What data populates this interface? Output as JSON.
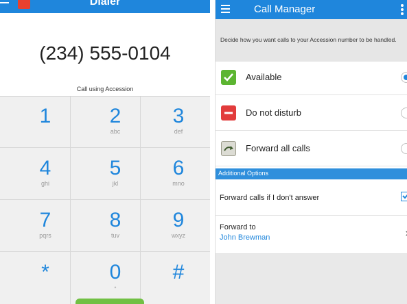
{
  "dialer": {
    "title": "Dialer",
    "phone_number": "(234) 555-0104",
    "call_using_label": "Call using Accession",
    "keys": [
      {
        "digit": "1",
        "letters": ""
      },
      {
        "digit": "2",
        "letters": "abc"
      },
      {
        "digit": "3",
        "letters": "def"
      },
      {
        "digit": "4",
        "letters": "ghi"
      },
      {
        "digit": "5",
        "letters": "jkl"
      },
      {
        "digit": "6",
        "letters": "mno"
      },
      {
        "digit": "7",
        "letters": "pqrs"
      },
      {
        "digit": "8",
        "letters": "tuv"
      },
      {
        "digit": "9",
        "letters": "wxyz"
      },
      {
        "digit": "*",
        "letters": ""
      },
      {
        "digit": "0",
        "letters": ""
      },
      {
        "digit": "#",
        "letters": ""
      }
    ],
    "call_button_color": "#71c044"
  },
  "call_manager": {
    "title": "Call Manager",
    "description": "Decide how you want calls to your Accession number to be handled.",
    "options": [
      {
        "label": "Available",
        "icon": "checkmark-icon",
        "color": "#5cb531",
        "selected": true
      },
      {
        "label": "Do not disturb",
        "icon": "minus-icon",
        "color": "#e23c3c",
        "selected": false
      },
      {
        "label": "Forward all calls",
        "icon": "forward-arrow-icon",
        "color": "#4a5a4a",
        "selected": false
      }
    ],
    "additional_options_header": "Additional Options",
    "forward_if_no_answer": {
      "label": "Forward calls if I don't answer",
      "checked": true
    },
    "forward_to": {
      "label": "Forward to",
      "value": "John Brewman"
    }
  },
  "colors": {
    "accent": "#1f86dc",
    "header_bg": "#1f86dc"
  }
}
